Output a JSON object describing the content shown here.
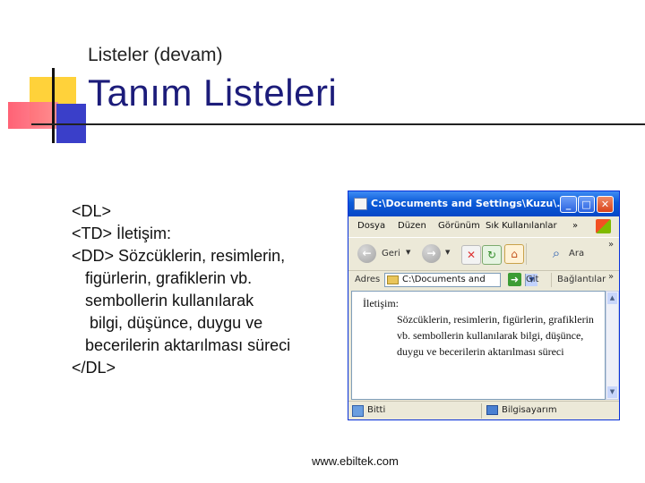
{
  "slide": {
    "subtitle": "Listeler (devam)",
    "title": "Tanım Listeleri",
    "code_lines": [
      "<DL>",
      "<TD> İletişim:",
      "<DD> Sözcüklerin, resimlerin,",
      "   figürlerin, grafiklerin vb.",
      "   sembollerin kullanılarak",
      "    bilgi, düşünce, duygu ve",
      "   becerilerin aktarılması süreci",
      "</DL>"
    ],
    "footer": "www.ebiltek.com"
  },
  "window": {
    "title": "C:\\Documents and Settings\\Kuzu\\...",
    "minimize": "_",
    "maximize": "□",
    "close": "✕",
    "menu": [
      "Dosya",
      "Düzen",
      "Görünüm",
      "Sık Kullanılanlar"
    ],
    "menu_more": "»",
    "toolbar": {
      "back": "Geri",
      "search": "Ara",
      "more": "»"
    },
    "address": {
      "label": "Adres",
      "value": "C:\\Documents and Se",
      "go": "Git",
      "links": "Bağlantılar",
      "more": "»"
    },
    "content": {
      "term": "İletişim:",
      "definition": "Sözcüklerin, resimlerin, figürlerin, grafiklerin vb. sembollerin kullanılarak bilgi, düşünce, duygu ve becerilerin aktarılması süreci"
    },
    "status": {
      "left": "Bitti",
      "right": "Bilgisayarım"
    }
  },
  "icons": {
    "back": "back-arrow-icon",
    "forward": "forward-arrow-icon",
    "search": "search-icon",
    "go": "go-arrow-icon"
  },
  "colors": {
    "title": "#1c1c7a",
    "titlebar": "#0a5ad8"
  }
}
